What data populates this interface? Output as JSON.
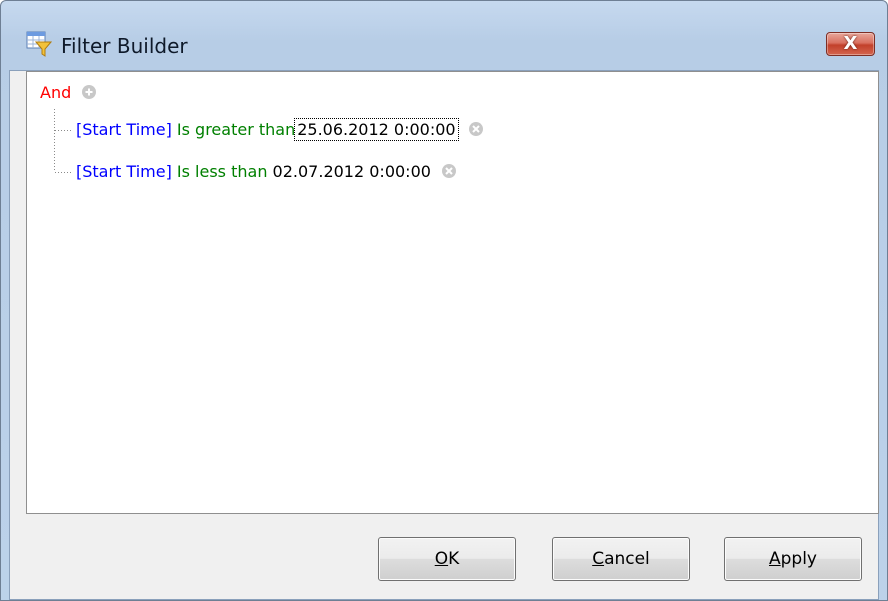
{
  "window": {
    "title": "Filter Builder",
    "close_symbol": "X"
  },
  "tree": {
    "group_operator": "And",
    "conditions": [
      {
        "field": "[Start Time]",
        "operator": "Is greater than",
        "value": "25.06.2012 0:00:00",
        "focused": true
      },
      {
        "field": "[Start Time]",
        "operator": "Is less than",
        "value": "02.07.2012 0:00:00",
        "focused": false
      }
    ]
  },
  "buttons": {
    "ok": {
      "accel": "O",
      "rest": "K"
    },
    "cancel": {
      "accel": "C",
      "rest": "ancel"
    },
    "apply": {
      "accel": "A",
      "rest": "pply"
    }
  },
  "icons": {
    "app": "filter-builder-icon",
    "add": "add-condition-icon",
    "remove": "remove-condition-icon",
    "close": "close-icon"
  },
  "colors": {
    "group_operator": "#ff0000",
    "field": "#0000ff",
    "operator": "#008000",
    "value": "#000000",
    "close_button": "#c2402b"
  }
}
